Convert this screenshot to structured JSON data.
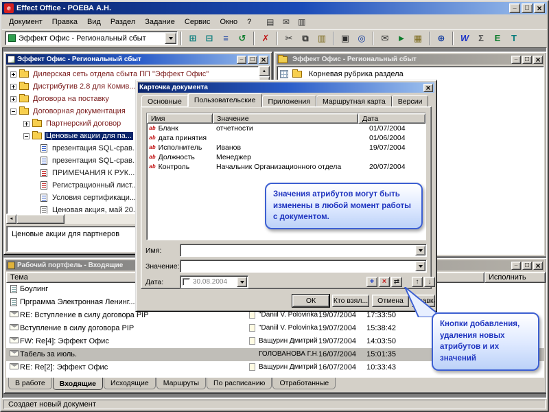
{
  "app": {
    "title": "Effect Office - РОЕВА А.Н.",
    "logo": "e",
    "menu": [
      "Документ",
      "Правка",
      "Вид",
      "Раздел",
      "Задание",
      "Сервис",
      "Окно",
      "?"
    ],
    "status": "Создает новый документ"
  },
  "toolbar": {
    "section_combo": "Эффект Офис - Региональный сбыт",
    "menu_icons": [
      {
        "name": "new-document-icon",
        "glyph": "▤"
      },
      {
        "name": "mail-icon",
        "glyph": "✉"
      },
      {
        "name": "print-icon",
        "glyph": "▥"
      }
    ],
    "buttons": [
      {
        "name": "tree-view-icon",
        "glyph": "⊞"
      },
      {
        "name": "card-view-icon",
        "glyph": "⊟"
      },
      {
        "name": "list-view-icon",
        "glyph": "≡"
      },
      {
        "name": "refresh-icon",
        "glyph": "↺"
      },
      {
        "name": "delete-icon",
        "glyph": "✗"
      },
      {
        "name": "cut-icon",
        "glyph": "✂"
      },
      {
        "name": "copy-icon",
        "glyph": "⧉"
      },
      {
        "name": "paste-icon",
        "glyph": "▥"
      },
      {
        "name": "print-icon",
        "glyph": "▣"
      },
      {
        "name": "search-icon",
        "glyph": "◎"
      },
      {
        "name": "mail-icon",
        "glyph": "✉"
      },
      {
        "name": "send-icon",
        "glyph": "►"
      },
      {
        "name": "archive-icon",
        "glyph": "▦"
      },
      {
        "name": "network-icon",
        "glyph": "⊕"
      },
      {
        "name": "word-export-icon",
        "glyph": "W"
      },
      {
        "name": "sum-icon",
        "glyph": "Σ"
      },
      {
        "name": "excel-export-icon",
        "glyph": "E"
      },
      {
        "name": "text-export-icon",
        "glyph": "T"
      }
    ]
  },
  "tree_window": {
    "title": "Эффект Офис - Региональный сбыт",
    "items": [
      {
        "label": "Дилерская сеть отдела сбыта ПП \"Эффект Офис\""
      },
      {
        "label": "Дистрибутив 2.8 для Комив..."
      },
      {
        "label": "Договора на поставку"
      },
      {
        "label": "Договорная документация"
      },
      {
        "label": "Партнерский договор"
      },
      {
        "label": "Ценовые акции для па..."
      },
      {
        "label": "презентация SQL-срав..."
      },
      {
        "label": "презентация SQL-срав..."
      },
      {
        "label": "ПРИМЕЧАНИЯ К РУК..."
      },
      {
        "label": "Регистрационный лист..."
      },
      {
        "label": "Условия сертификаци..."
      },
      {
        "label": "Ценовая акция, май 20..."
      }
    ],
    "description": "Ценовые акции для партнеров"
  },
  "section_window": {
    "title": "Эффект Офис - Региональный сбыт",
    "item": "Корневая рубрика раздела"
  },
  "dialog": {
    "title": "Карточка документа",
    "tabs": [
      "Основные",
      "Пользовательские",
      "Приложения",
      "Маршрутная карта",
      "Версии"
    ],
    "columns": [
      "Имя",
      "Значение",
      "Дата"
    ],
    "rows": [
      {
        "name": "Бланк",
        "value": "отчетности",
        "date": "01/07/2004"
      },
      {
        "name": "дата принятия",
        "value": "",
        "date": "01/06/2004"
      },
      {
        "name": "Исполнитель",
        "value": "Иванов",
        "date": "19/07/2004"
      },
      {
        "name": "Должность",
        "value": "Менеджер",
        "date": ""
      },
      {
        "name": "Контроль",
        "value": "Начальник Организационного отдела",
        "date": "20/07/2004"
      }
    ],
    "fields": {
      "name_label": "Имя:",
      "value_label": "Значение:",
      "date_label": "Дата:",
      "date_value": "30.08.2004"
    },
    "attr_buttons": [
      {
        "name": "add-attribute-icon",
        "glyph": "+"
      },
      {
        "name": "delete-attribute-icon",
        "glyph": "×"
      },
      {
        "name": "swap-attribute-icon",
        "glyph": "⇄"
      },
      {
        "name": "move-up-icon",
        "glyph": "↑"
      },
      {
        "name": "move-down-icon",
        "glyph": "↓"
      }
    ],
    "buttons": [
      "ОК",
      "Кто взял...",
      "Отмена",
      "Справка"
    ]
  },
  "callouts": {
    "attributes": "Значения атрибутов могут быть изменены в любой момент работы с документом.",
    "buttons": "Кнопки добавления, удаления новых атрибутов и их значений"
  },
  "inbox_window": {
    "title": "Рабочий портфель - Входящие",
    "columns": {
      "subject": "Тема",
      "execute": "Исполнить"
    },
    "rows": [
      {
        "subject": "Боулинг",
        "sender": "",
        "date": "",
        "time": ""
      },
      {
        "subject": "Прграмма Электронная Ленинг...",
        "sender": "",
        "date": "",
        "time": ""
      },
      {
        "subject": "RE: Вступление в силу договора PIP",
        "sender": "\"Daniil V. Polovinka ...",
        "date": "19/07/2004",
        "time": "17:33:50"
      },
      {
        "subject": "Вступление в силу договора PIP",
        "sender": "\"Daniil V. Polovinka ...",
        "date": "19/07/2004",
        "time": "15:38:42"
      },
      {
        "subject": "FW: Re[4]: Эффект Офис",
        "sender": "Ващурин Дмитрий ...",
        "date": "19/07/2004",
        "time": "14:03:50"
      },
      {
        "subject": "Табель за июль.",
        "sender": "ГОЛОВАНОВА Г.Н.",
        "date": "16/07/2004",
        "time": "15:01:35"
      },
      {
        "subject": "RE: Re[2]: Эффект Офис",
        "sender": "Ващурин Дмитрий ...",
        "date": "16/07/2004",
        "time": "10:33:43"
      }
    ],
    "tabs": [
      "В работе",
      "Входящие",
      "Исходящие",
      "Маршруты",
      "По расписанию",
      "Отработанные"
    ],
    "active_tab": "Входящие"
  }
}
